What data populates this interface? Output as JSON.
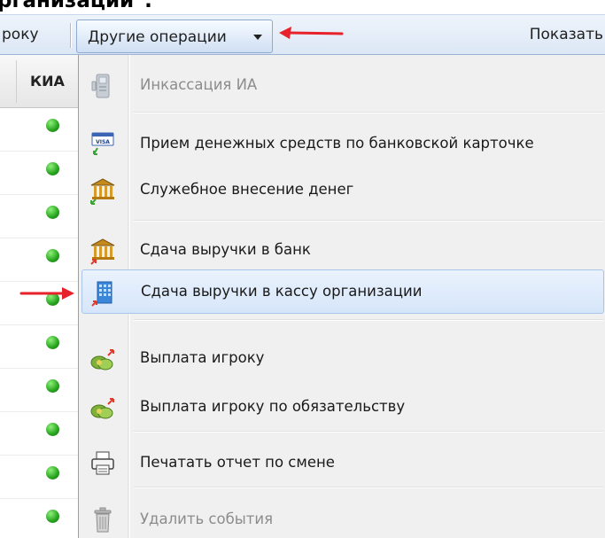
{
  "caption": "рганизации\".",
  "toolbar": {
    "left_label": "року",
    "other_ops_label": "Другие операции",
    "right_label": "Показать"
  },
  "grid": {
    "header_label": "КИА",
    "status_color": "#2ea824"
  },
  "menu": {
    "items": [
      {
        "label": "Инкассация ИА",
        "icon": "atm-terminal-icon",
        "disabled": true
      },
      {
        "label": "Прием денежных средств по банковской карточке",
        "icon": "visa-card-icon",
        "disabled": false
      },
      {
        "label": "Служебное внесение денег",
        "icon": "bank-building-in-icon",
        "disabled": false
      },
      {
        "label": "Сдача выручки в банк",
        "icon": "bank-building-out-icon",
        "disabled": false
      },
      {
        "label": "Сдача выручки в кассу организации",
        "icon": "office-building-icon",
        "disabled": false,
        "highlighted": true
      },
      {
        "label": "Выплата игроку",
        "icon": "money-payout-icon",
        "disabled": false
      },
      {
        "label": "Выплата игроку по обязательству",
        "icon": "money-obligation-icon",
        "disabled": false
      },
      {
        "label": "Печатать отчет по смене",
        "icon": "printer-icon",
        "disabled": false
      },
      {
        "label": "Удалить события",
        "icon": "trash-icon",
        "disabled": true
      }
    ]
  },
  "annotations": {
    "arrow_color": "#e8222a"
  }
}
